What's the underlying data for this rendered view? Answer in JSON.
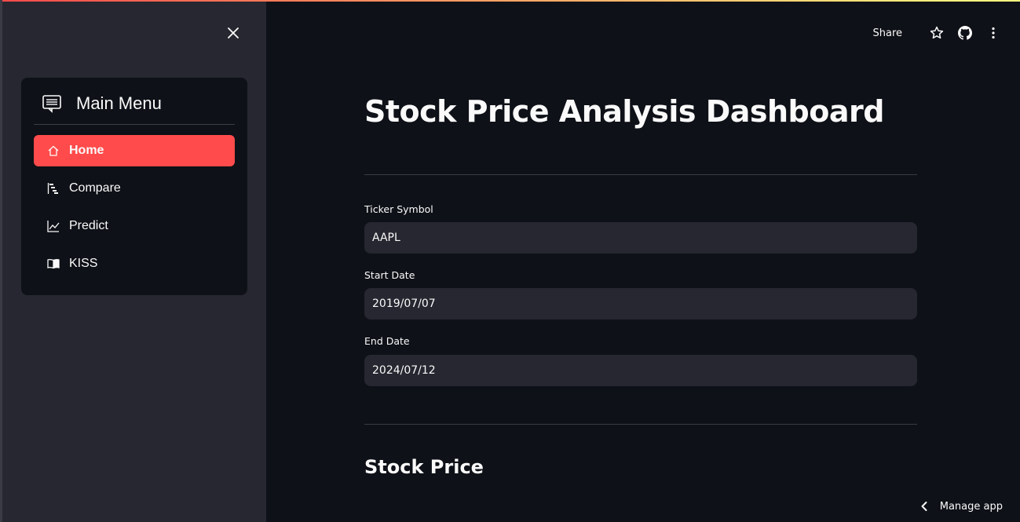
{
  "sidebar": {
    "close_icon": "close-icon",
    "menu": {
      "title": "Main Menu",
      "icon": "menu-list-icon",
      "active_color": "#ff4b4b",
      "items": [
        {
          "label": "Home",
          "icon": "house-icon",
          "active": true
        },
        {
          "label": "Compare",
          "icon": "bar-chart-steps-icon",
          "active": false
        },
        {
          "label": "Predict",
          "icon": "graph-up-icon",
          "active": false
        },
        {
          "label": "KISS",
          "icon": "book-icon",
          "active": false
        }
      ]
    }
  },
  "toolbar": {
    "share_label": "Share",
    "icons": [
      "star-icon",
      "github-icon",
      "more-vertical-icon"
    ]
  },
  "main": {
    "title": "Stock Price Analysis Dashboard",
    "fields": [
      {
        "label": "Ticker Symbol",
        "value": "AAPL"
      },
      {
        "label": "Start Date",
        "value": "2019/07/07"
      },
      {
        "label": "End Date",
        "value": "2024/07/12"
      }
    ],
    "section_title": "Stock Price"
  },
  "footer": {
    "manage_app_label": "Manage app"
  },
  "colors": {
    "background": "#0e1117",
    "sidebar": "#262730",
    "accent": "#ff4b4b",
    "input_bg": "#262730"
  }
}
